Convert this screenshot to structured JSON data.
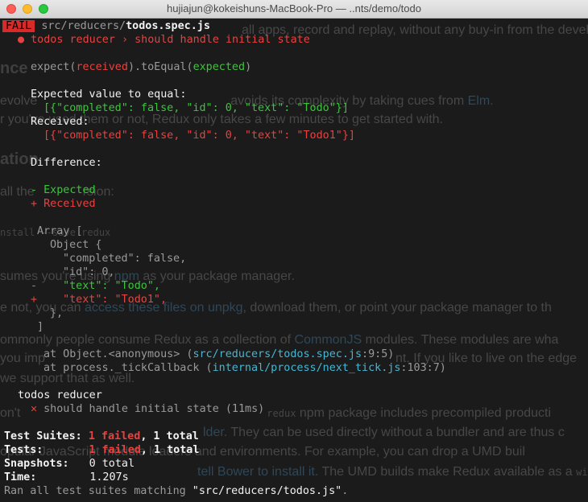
{
  "window": {
    "title": "hujiajun@kokeishuns-MacBook-Pro — ..nts/demo/todo"
  },
  "background_page": {
    "line1": "all apps, record and replay, without any buy-in from the devel",
    "heading1": "nce",
    "line2_a": "evolve",
    "line2_b": "avoids its complexity by taking cues from",
    "line2_link": "Elm.",
    "line3": "r you've used them or not, Redux only takes a few minutes to get started with.",
    "heading2": "ation",
    "line4": "all the",
    "line4_b": "rsion:",
    "line5": "nstall --save redux",
    "line6_a": "sumes you're using",
    "line6_link": "npm",
    "line6_b": "as your package manager.",
    "line7_a": "e not, you can",
    "line7_link": "access these files on unpkg",
    "line7_b": ", download them, or point your package manager to th",
    "line8_a": "ommonly people consume Redux as a collection of",
    "line8_link": "CommonJS",
    "line8_b": "modules. These modules are wha",
    "line9_a": "you imp",
    "line9_b": "nt. If you like to live on the edge",
    "line10": "we support that as well.",
    "line11_a": "on't",
    "line11_b": "npm package includes precompiled producti",
    "line11_code": "redux",
    "line12_link": "lder",
    "line12_b": ". They can be used directly without a bundler and are thus c",
    "line13": "opular JavaScript module loaders and environments. For example, you can drop a UMD buil",
    "line14_link": "tell Bower to install it",
    "line14_b": ". The UMD builds make Redux available as a",
    "line14_code": "window.R"
  },
  "terminal": {
    "fail_badge": "FAIL",
    "spec_dir": "src/reducers/",
    "spec_file": "todos.spec.js",
    "bullet": "●",
    "test_title": "todos reducer › should handle initial state",
    "expect_a": "expect(",
    "expect_received": "received",
    "expect_b": ").toEqual(",
    "expect_expected": "expected",
    "expect_c": ")",
    "expected_label": "Expected value to equal:",
    "expected_value": "[{\"completed\": false, \"id\": 0, \"text\": \"Todo\"}]",
    "received_label": "Received:",
    "received_value": "[{\"completed\": false, \"id\": 0, \"text\": \"Todo1\"}]",
    "difference_label": "Difference:",
    "minus_expected": "- Expected",
    "plus_received": "+ Received",
    "diff_array": "Array [",
    "diff_object": "Object {",
    "diff_completed": "\"completed\": false,",
    "diff_id": "\"id\": 0,",
    "diff_minus_sign": "-",
    "diff_text_old": "\"text\": \"Todo\",",
    "diff_plus_sign": "+",
    "diff_text_new": "\"text\": \"Todo1\",",
    "diff_close_obj": "},",
    "diff_close_arr": "]",
    "stack1_a": "at Object.<anonymous> (",
    "stack1_path": "src/reducers/todos.spec.js",
    "stack1_b": ":9:5)",
    "stack2_a": "at process._tickCallback (",
    "stack2_path": "internal/process/next_tick.js",
    "stack2_b": ":103:7)",
    "suite_name": "todos reducer",
    "cross": "✕",
    "test_result": "should handle initial state (11ms)",
    "summary": {
      "suites_label": "Test Suites:",
      "suites_failed": "1 failed",
      "suites_total": ", 1 total",
      "tests_label": "Tests:",
      "tests_failed": "1 failed",
      "tests_total": ", 1 total",
      "snapshots_label": "Snapshots:",
      "snapshots_value": "0 total",
      "time_label": "Time:",
      "time_value": "1.207s",
      "ran_a": "Ran all test suites matching ",
      "ran_pattern": "\"src/reducers/todos.js\"",
      "ran_b": "."
    }
  }
}
